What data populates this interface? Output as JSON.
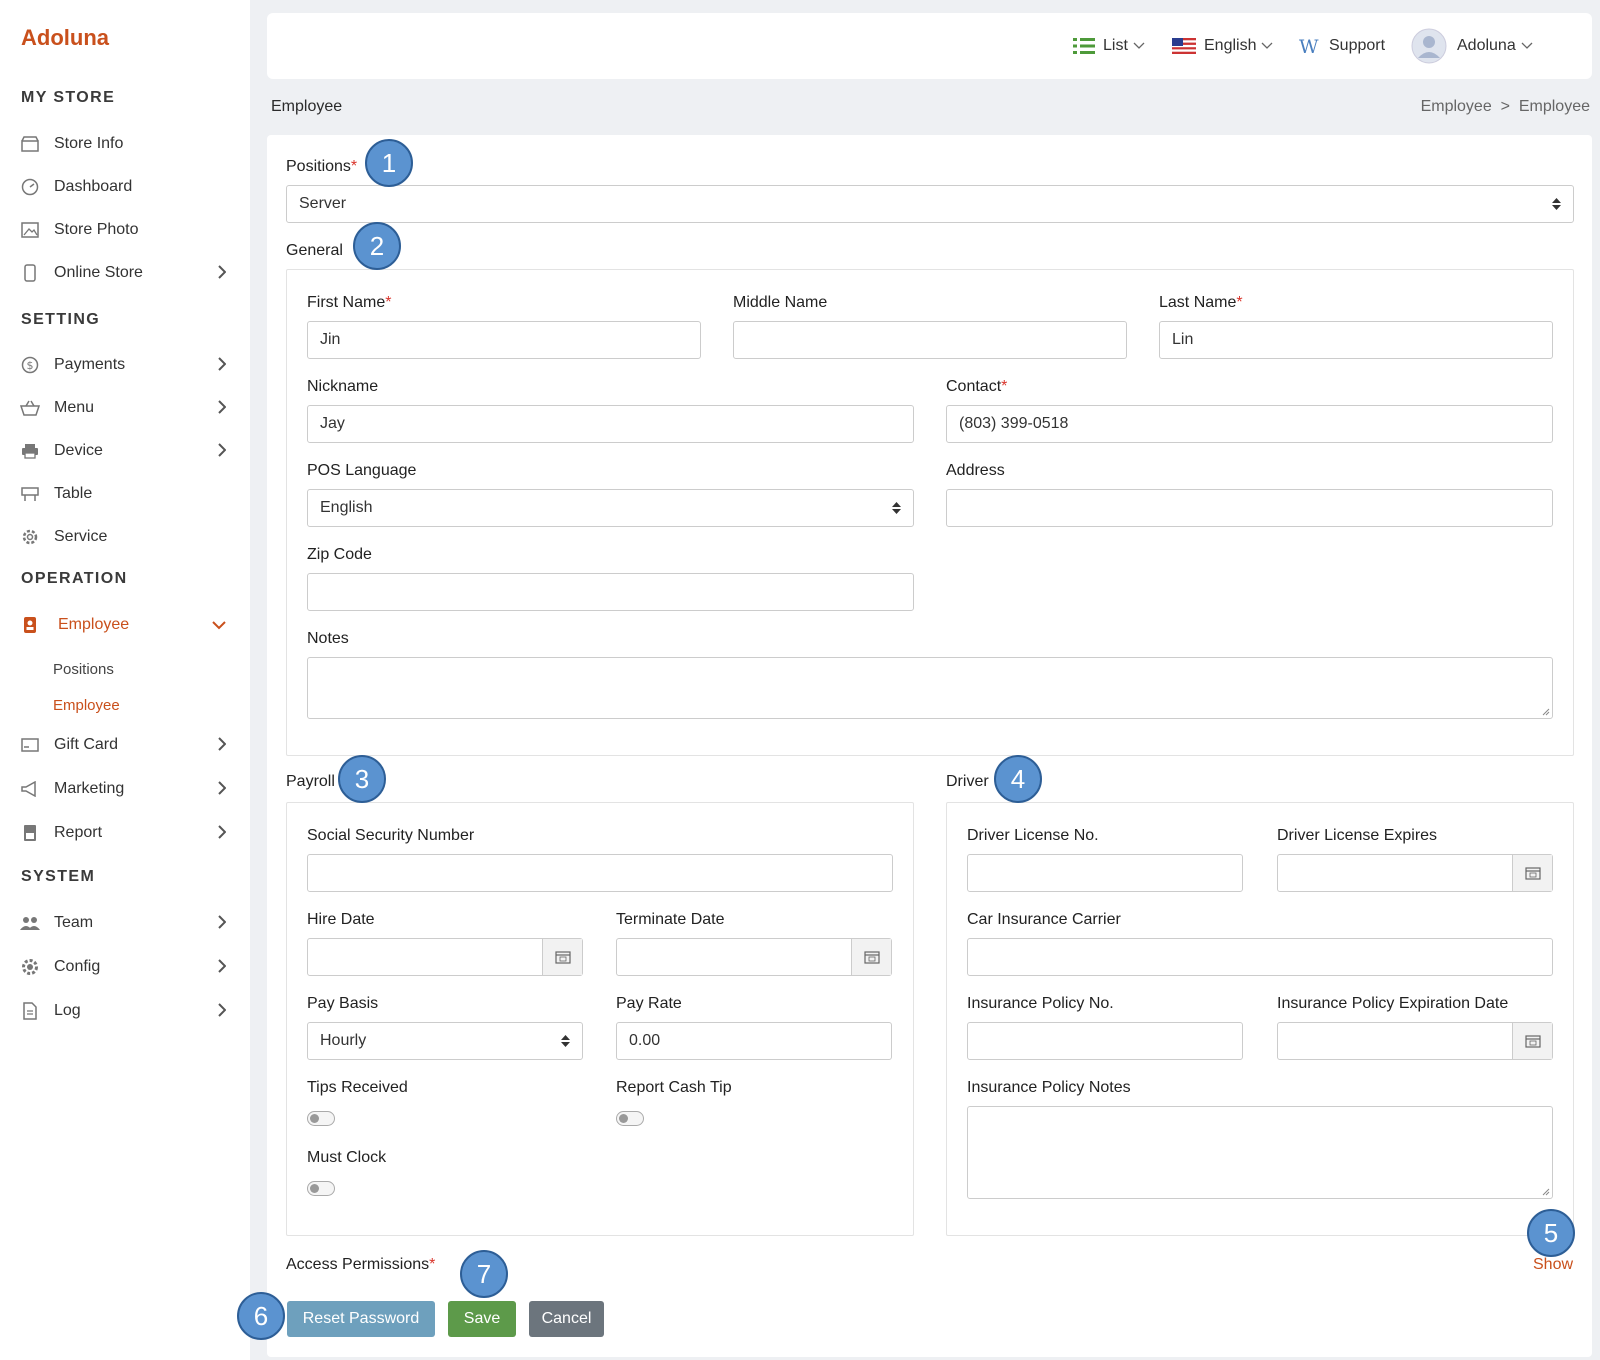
{
  "brand": "Adoluna",
  "sidebar": {
    "my_store": {
      "title": "MY STORE",
      "items": [
        {
          "label": "Store Info",
          "icon": "store-icon"
        },
        {
          "label": "Dashboard",
          "icon": "dashboard-icon"
        },
        {
          "label": "Store Photo",
          "icon": "photo-icon"
        },
        {
          "label": "Online Store",
          "icon": "mobile-icon"
        }
      ]
    },
    "setting": {
      "title": "SETTING",
      "items": [
        {
          "label": "Payments",
          "icon": "dollar-icon"
        },
        {
          "label": "Menu",
          "icon": "basket-icon"
        },
        {
          "label": "Device",
          "icon": "printer-icon"
        },
        {
          "label": "Table",
          "icon": "table-icon"
        },
        {
          "label": "Service",
          "icon": "gear-icon"
        }
      ]
    },
    "operation": {
      "title": "OPERATION",
      "employee": "Employee",
      "sub_items": [
        "Positions",
        "Employee"
      ],
      "items": [
        {
          "label": "Gift Card",
          "icon": "gift-card-icon"
        },
        {
          "label": "Marketing",
          "icon": "megaphone-icon"
        },
        {
          "label": "Report",
          "icon": "report-icon"
        }
      ]
    },
    "system": {
      "title": "SYSTEM",
      "items": [
        {
          "label": "Team",
          "icon": "team-icon"
        },
        {
          "label": "Config",
          "icon": "config-icon"
        },
        {
          "label": "Log",
          "icon": "log-icon"
        }
      ]
    }
  },
  "topbar": {
    "list": "List",
    "language": "English",
    "support": "Support",
    "user": "Adoluna"
  },
  "breadcrumb": {
    "title": "Employee",
    "path": "Employee  >  Employee"
  },
  "form": {
    "positions_label": "Positions",
    "positions_value": "Server",
    "general_label": "General",
    "first_name_label": "First Name",
    "first_name_value": "Jin",
    "middle_name_label": "Middle Name",
    "middle_name_value": "",
    "last_name_label": "Last Name",
    "last_name_value": "Lin",
    "nickname_label": "Nickname",
    "nickname_value": "Jay",
    "contact_label": "Contact",
    "contact_value": "(803) 399-0518",
    "pos_language_label": "POS Language",
    "pos_language_value": "English",
    "address_label": "Address",
    "zip_label": "Zip Code",
    "notes_label": "Notes",
    "payroll_label": "Payroll",
    "ssn_label": "Social Security Number",
    "hire_date_label": "Hire Date",
    "terminate_date_label": "Terminate Date",
    "pay_basis_label": "Pay Basis",
    "pay_basis_value": "Hourly",
    "pay_rate_label": "Pay Rate",
    "pay_rate_value": "0.00",
    "tips_received_label": "Tips Received",
    "report_cash_tip_label": "Report Cash Tip",
    "must_clock_label": "Must Clock",
    "driver_label": "Driver",
    "driver_license_label": "Driver License No.",
    "driver_license_expires_label": "Driver License Expires",
    "car_insurance_label": "Car Insurance Carrier",
    "policy_no_label": "Insurance Policy No.",
    "policy_exp_label": "Insurance Policy Expiration Date",
    "policy_notes_label": "Insurance Policy Notes",
    "access_permissions_label": "Access Permissions",
    "show_link": "Show",
    "reset_password": "Reset Password",
    "save": "Save",
    "cancel": "Cancel",
    "toggles": {
      "tips_received": false,
      "report_cash_tip": false,
      "must_clock": false
    }
  },
  "badges": [
    "1",
    "2",
    "3",
    "4",
    "5",
    "6",
    "7"
  ],
  "colors": {
    "brand": "#c9501c",
    "badge": "#5b93d0",
    "reset": "#6ea0bd",
    "save": "#5d9a4a",
    "cancel": "#6c757d"
  }
}
